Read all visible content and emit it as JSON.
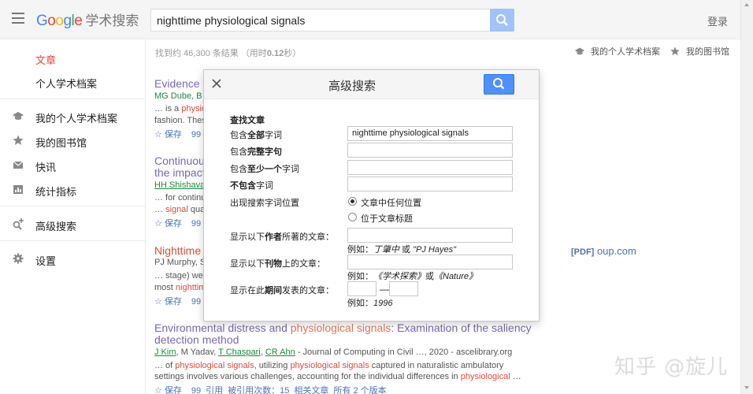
{
  "header": {
    "logo_letters": [
      "G",
      "o",
      "o",
      "g",
      "l",
      "e"
    ],
    "logo_suffix": "学术搜索",
    "search_value": "nighttime physiological signals",
    "login_label": "登录"
  },
  "sidebar": {
    "items": [
      {
        "label": "文章",
        "icon": "none"
      },
      {
        "label": "个人学术档案",
        "icon": "none"
      },
      {
        "label": "我的个人学术档案",
        "icon": "graduation-cap-icon"
      },
      {
        "label": "我的图书馆",
        "icon": "star-icon"
      },
      {
        "label": "快讯",
        "icon": "mail-icon"
      },
      {
        "label": "统计指标",
        "icon": "chart-icon"
      },
      {
        "label": "高级搜索",
        "icon": "search-plus-icon"
      },
      {
        "label": "设置",
        "icon": "gear-icon"
      }
    ]
  },
  "results_header": {
    "stats": "找到约 46,300 条结果 （用时",
    "stats_time": "0.12",
    "stats_end": "秒）",
    "my_profile": "我的个人学术档案",
    "my_library": "我的图书馆"
  },
  "results": [
    {
      "title": "Evidence t",
      "meta": "MG Dube, B X",
      "snippet1_pre": "… is a ",
      "snippet1_hl": "physio",
      "snippet2": "fashion. These",
      "action_save": "保存",
      "action_cite": "99"
    },
    {
      "title1": "Continuous",
      "title2": "the impact",
      "meta": "HH Shishavar",
      "snippet1": "… for continu",
      "snippet2_pre": "… ",
      "snippet2_hl": "signal",
      "snippet2_post": " qual",
      "action_save": "保存",
      "action_cite": "99"
    },
    {
      "title": "Nighttime c",
      "meta": "PJ Murphy, SS",
      "snippet1": "… stage) were",
      "snippet2_pre": "most ",
      "snippet2_hl": "nighttim",
      "action_save": "保存",
      "action_cite": "99",
      "pdf_tag": "[PDF]",
      "pdf_source": "oup.com"
    },
    {
      "title_pre": "Environmental distress and ",
      "title_hl": "physiological signals",
      "title_post": ": Examination of the saliency",
      "title_line2": "detection method",
      "authors": [
        "J Kim",
        "M Yadav",
        "T Chaspari",
        "CR Ahn"
      ],
      "meta_source": " - Journal of Computing in Civil …, 2020 - ascelibrary.org",
      "snippet1_pre": "… of ",
      "snippet1_hl1": "physiological signals",
      "snippet1_mid": ", utilizing ",
      "snippet1_hl2": "physiological signals",
      "snippet1_post": " captured in naturalistic ambulatory",
      "snippet2_pre": "settings involves various challenges, accounting for the individual differences in ",
      "snippet2_hl": "physiological",
      "snippet2_post": " …",
      "actions": [
        "保存",
        "99",
        "引用",
        "被引用次数：15",
        "相关文章",
        "所有 2 个版本"
      ]
    }
  ],
  "dialog": {
    "title": "高级搜索",
    "section": "查找文章",
    "all_words_pre": "包含",
    "all_words_b": "全部",
    "all_words_post": "字词",
    "all_words_value": "nighttime physiological signals",
    "phrase_pre": "包含",
    "phrase_b": "完整字句",
    "any_pre": "包含",
    "any_b": "至少一个",
    "any_post": "字词",
    "none_b": "不包含",
    "none_post": "字词",
    "where_label": "出现搜索字词位置",
    "where_opt1": "文章中任何位置",
    "where_opt2": "位于文章标题",
    "author_pre": "显示以下",
    "author_b": "作者",
    "author_post": "所著的文章：",
    "author_hint_pre": "例如：",
    "author_hint": "丁肇中",
    "author_hint_or": " 或 ",
    "author_hint2": "\"PJ Hayes\"",
    "pub_pre": "显示以下",
    "pub_b": "刊物",
    "pub_post": "上的文章：",
    "pub_hint_pre": "例如：",
    "pub_hint": "《学术探索》",
    "pub_hint_or": "或",
    "pub_hint2": "《Nature》",
    "date_pre": "显示在此",
    "date_b": "期间",
    "date_post": "发表的文章：",
    "date_dash": "—",
    "date_hint_pre": "例如：",
    "date_hint": "1996"
  },
  "watermark": "知乎 @旋儿"
}
